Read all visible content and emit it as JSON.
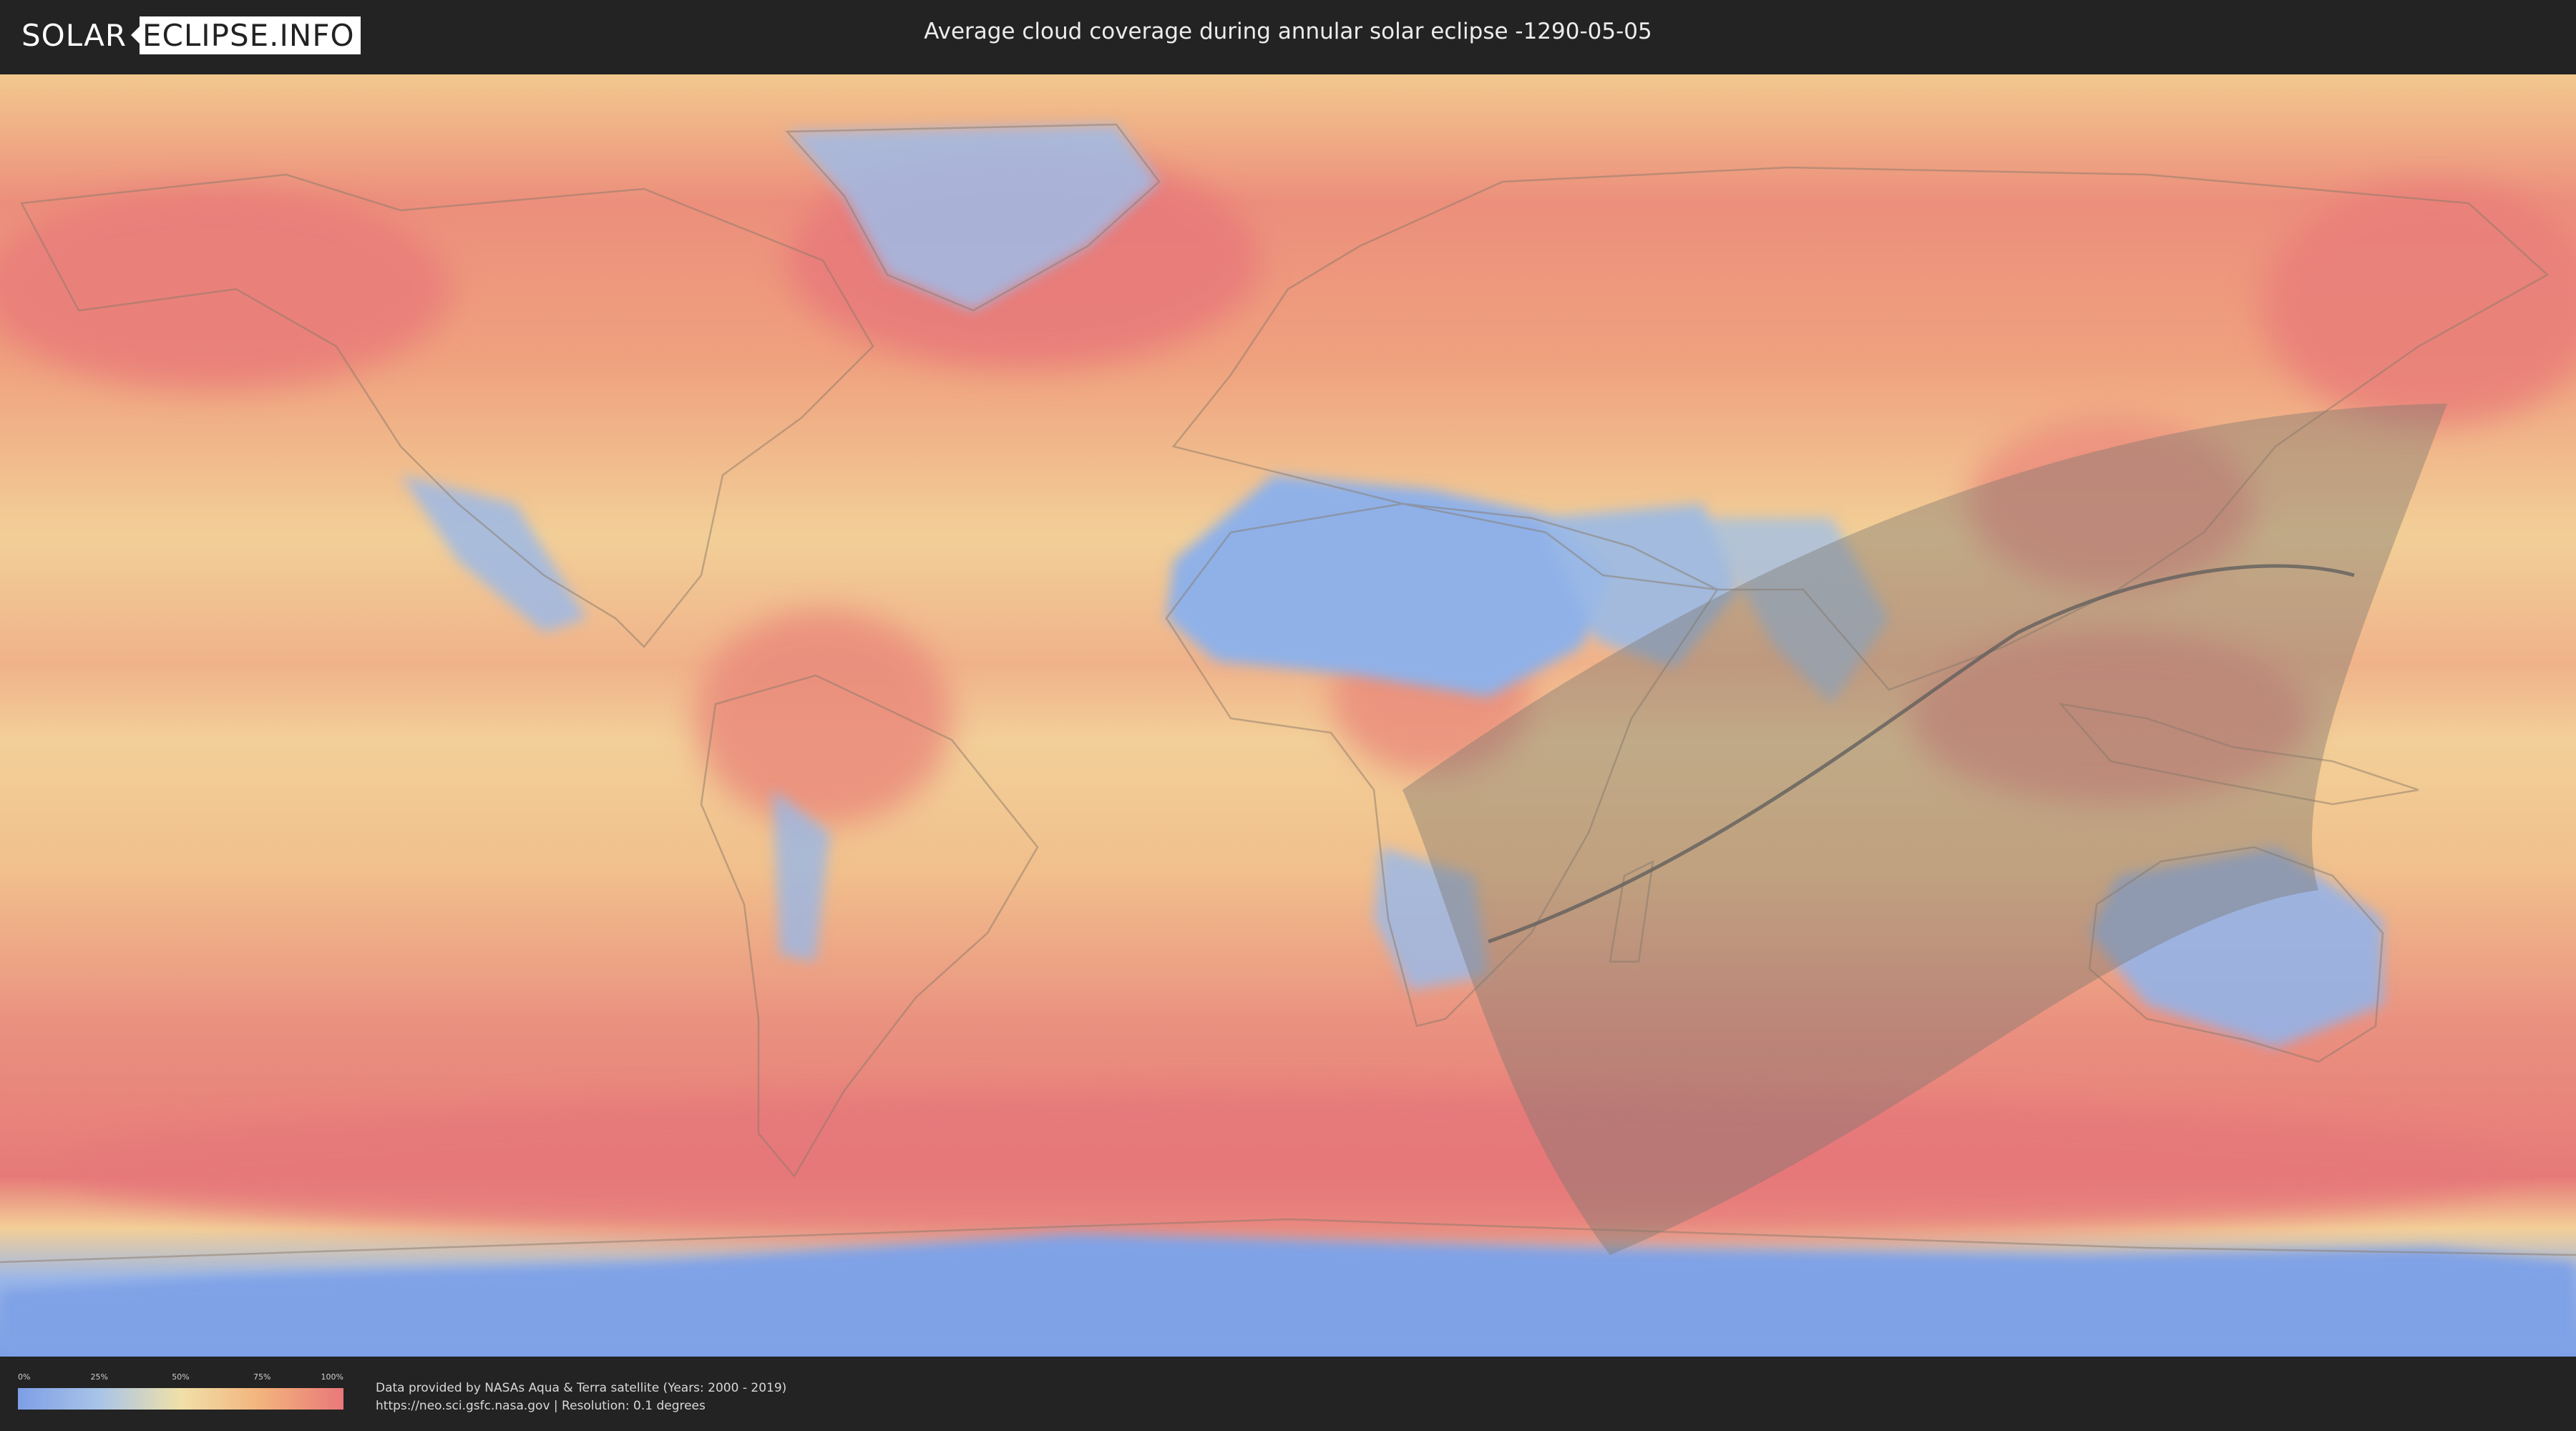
{
  "header": {
    "logo_left": "SOLAR",
    "logo_right": "ECLIPSE.INFO",
    "title": "Average cloud coverage during annular solar eclipse -1290-05-05"
  },
  "legend": {
    "ticks": [
      "0%",
      "25%",
      "50%",
      "75%",
      "100%"
    ],
    "colors": [
      "#7e9ee6",
      "#a8c4e8",
      "#f0e0a8",
      "#f3b27c",
      "#e9787a"
    ]
  },
  "footer": {
    "credit_line1": "Data provided by NASAs Aqua & Terra satellite (Years: 2000 - 2019)",
    "credit_line2": "https://neo.sci.gsfc.nasa.gov | Resolution: 0.1 degrees"
  },
  "map": {
    "projection": "equirectangular",
    "colors": {
      "clear_sky": "#8fb0e6",
      "mid": "#f0d7a0",
      "cloudy": "#e77b78",
      "eclipse_shadow": "#7c766f",
      "central_line": "#5c5c5c",
      "coastline": "#8a7a6a"
    }
  }
}
